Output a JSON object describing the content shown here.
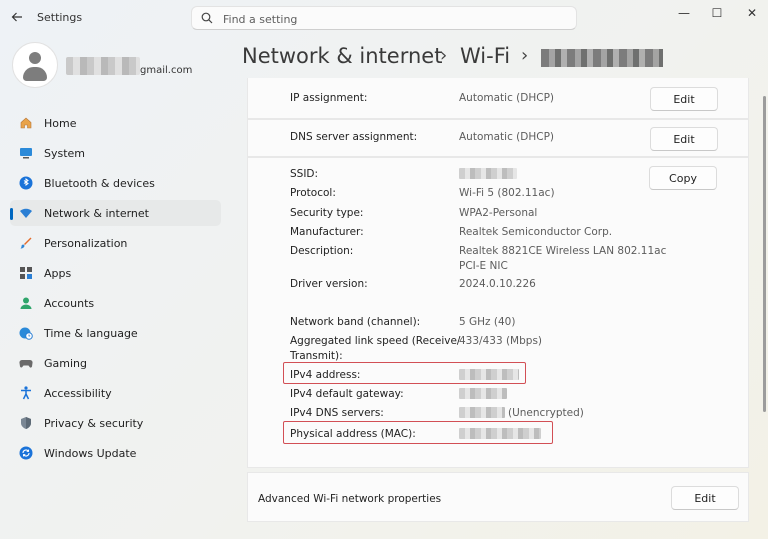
{
  "window": {
    "title": "Settings",
    "minimize": "—",
    "maximize": "☐",
    "close": "✕"
  },
  "search": {
    "placeholder": "Find a setting"
  },
  "user": {
    "email_suffix": "gmail.com"
  },
  "nav": [
    {
      "label": "Home",
      "icon": "home-icon"
    },
    {
      "label": "System",
      "icon": "system-icon"
    },
    {
      "label": "Bluetooth & devices",
      "icon": "bluetooth-icon"
    },
    {
      "label": "Network & internet",
      "icon": "wifi-icon",
      "selected": true
    },
    {
      "label": "Personalization",
      "icon": "brush-icon"
    },
    {
      "label": "Apps",
      "icon": "apps-icon"
    },
    {
      "label": "Accounts",
      "icon": "accounts-icon"
    },
    {
      "label": "Time & language",
      "icon": "globe-clock-icon"
    },
    {
      "label": "Gaming",
      "icon": "gamepad-icon"
    },
    {
      "label": "Accessibility",
      "icon": "accessibility-icon"
    },
    {
      "label": "Privacy & security",
      "icon": "shield-icon"
    },
    {
      "label": "Windows Update",
      "icon": "update-icon"
    }
  ],
  "breadcrumb": {
    "level1": "Network & internet",
    "level2": "Wi-Fi",
    "sep": "›"
  },
  "ip_assignment": {
    "label": "IP assignment:",
    "value": "Automatic (DHCP)",
    "button": "Edit"
  },
  "dns_assignment": {
    "label": "DNS server assignment:",
    "value": "Automatic (DHCP)",
    "button": "Edit"
  },
  "properties": {
    "copy_button": "Copy",
    "ssid": {
      "label": "SSID:"
    },
    "protocol": {
      "label": "Protocol:",
      "value": "Wi-Fi 5 (802.11ac)"
    },
    "security": {
      "label": "Security type:",
      "value": "WPA2-Personal"
    },
    "manufacturer": {
      "label": "Manufacturer:",
      "value": "Realtek Semiconductor Corp."
    },
    "description": {
      "label": "Description:",
      "value_line1": "Realtek 8821CE Wireless LAN 802.11ac",
      "value_line2": "PCI-E NIC"
    },
    "driver": {
      "label": "Driver version:",
      "value": "2024.0.10.226"
    },
    "band": {
      "label": "Network band (channel):",
      "value": "5 GHz (40)"
    },
    "link_speed": {
      "label_line1": "Aggregated link speed (Receive/",
      "label_line2": "Transmit):",
      "value": "433/433 (Mbps)"
    },
    "ipv4": {
      "label": "IPv4 address:"
    },
    "gateway": {
      "label": "IPv4 default gateway:"
    },
    "dns_servers": {
      "label": "IPv4 DNS servers:",
      "value_suffix": "(Unencrypted)"
    },
    "mac": {
      "label": "Physical address (MAC):"
    }
  },
  "advanced": {
    "label": "Advanced Wi-Fi network properties",
    "button": "Edit"
  },
  "colors": {
    "accent": "#0067c0",
    "highlight": "#d24f55"
  }
}
